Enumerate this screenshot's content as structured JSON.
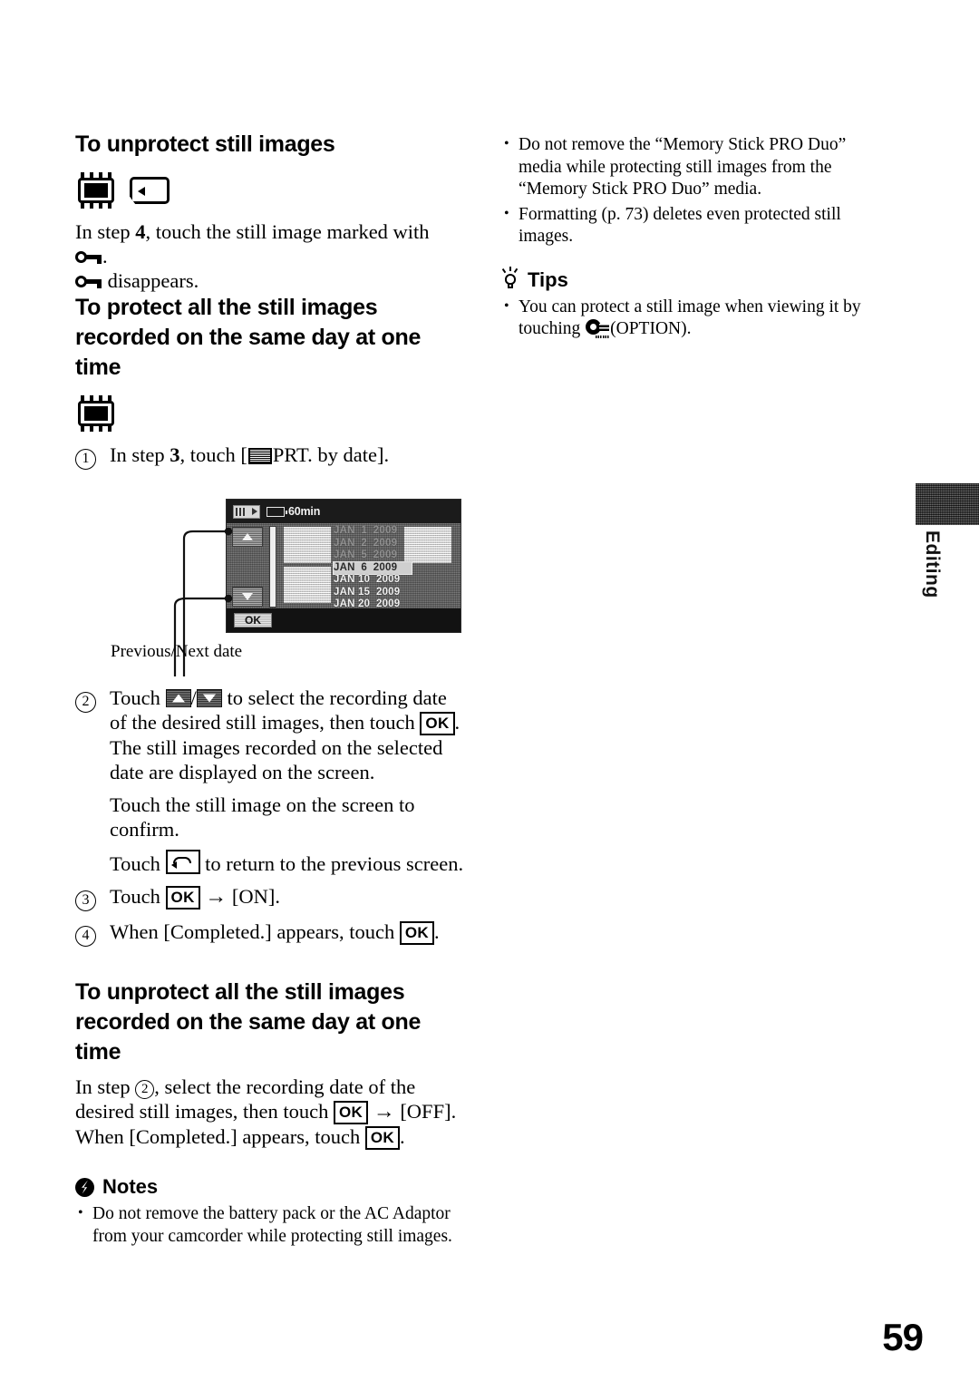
{
  "page": {
    "number": "59",
    "side_tab_label": "Editing"
  },
  "left_column": {
    "section1": {
      "heading": "To unprotect still images",
      "media_icons": [
        "memory-chip-icon",
        "memory-card-icon"
      ],
      "para1_pre": "In step ",
      "para1_bold": "4",
      "para1_post": ", touch the still image marked with",
      "para1_glyph_line": ".",
      "para2_post": " disappears."
    },
    "section2": {
      "heading_line1": "To protect all the still images",
      "heading_line2": "recorded on the same day at one time",
      "media_icons": [
        "memory-chip-icon"
      ],
      "step1": {
        "marker": "1",
        "pre": "In step ",
        "bold": "3",
        "mid": ", touch [",
        "chip": "prt-chip-icon",
        "post": "PRT. by date]."
      },
      "screen": {
        "battery_time": "60min",
        "prt_label": "PRT. by date",
        "ok_label": "OK",
        "dates": [
          {
            "text": "JAN  1  2009",
            "state": "faded"
          },
          {
            "text": "JAN  2  2009",
            "state": "faded"
          },
          {
            "text": "JAN  5  2009",
            "state": "faded"
          },
          {
            "text": "JAN  6  2009",
            "state": "selected"
          },
          {
            "text": "JAN 10  2009",
            "state": "normal"
          },
          {
            "text": "JAN 15  2009",
            "state": "normal"
          },
          {
            "text": "JAN 20  2009",
            "state": "normal"
          }
        ]
      },
      "caption": "Previous/Next date",
      "step2": {
        "marker": "2",
        "t1": "Touch ",
        "sep": "/",
        "t2": " to select the recording date of the desired still images, then touch ",
        "ok": "OK",
        "t3": ".",
        "p2": "The still images recorded on the selected date are displayed on the screen.",
        "p3_pre": "Touch the still image on the screen to confirm.",
        "p4_pre": "Touch ",
        "p4_post": " to return to the previous screen."
      },
      "step3": {
        "marker": "3",
        "pre": "Touch ",
        "ok": "OK",
        "mid": " ",
        "arrow": "→",
        "post": " [ON]."
      },
      "step4": {
        "marker": "4",
        "pre": "When [Completed.] appears, touch ",
        "ok": "OK",
        "post": "."
      }
    },
    "section3": {
      "heading_line1": "To unprotect all the still images",
      "heading_line2": "recorded on the same day at one time",
      "body_a": "In step ",
      "body_circled": "2",
      "body_b": ", select the recording date of the desired still images, then touch ",
      "ok1": "OK",
      "arrow": "→",
      "body_c": " [OFF]. When [Completed.] appears, touch ",
      "ok2": "OK",
      "body_d": "."
    },
    "notes": {
      "title": "Notes",
      "items": [
        "Do not remove the battery pack or the AC Adaptor from your camcorder while protecting still images."
      ]
    }
  },
  "right_column": {
    "notes_continued": [
      "Do not remove the “Memory Stick PRO Duo” media while protecting still images from the “Memory Stick PRO Duo” media.",
      "Formatting (p. 73) deletes even protected still images."
    ],
    "tips": {
      "title": "Tips",
      "item_pre": "You can protect a still image when viewing it by touching ",
      "item_post": "(OPTION)."
    }
  }
}
